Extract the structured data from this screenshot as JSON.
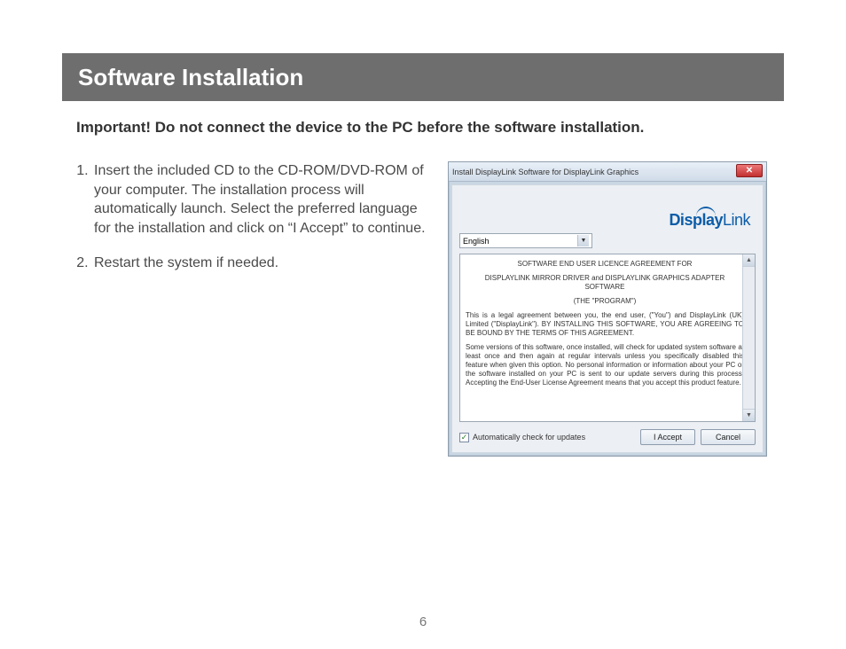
{
  "header": {
    "title": "Software Installation"
  },
  "notice": "Important!  Do not connect the device to the PC before the software installation.",
  "steps": [
    "Insert the included CD to the CD-ROM/DVD-ROM of your computer.  The installation process will automatically launch.  Select the preferred language for the installation and click on “I Accept” to continue.",
    "Restart the system if needed."
  ],
  "dialog": {
    "title": "Install DisplayLink Software for DisplayLink Graphics",
    "logo": {
      "bold_part": "Display",
      "reg_part": "Link"
    },
    "language": "English",
    "license": {
      "heading1": "SOFTWARE END USER LICENCE AGREEMENT FOR",
      "heading2": "DISPLAYLINK MIRROR DRIVER and DISPLAYLINK GRAPHICS ADAPTER SOFTWARE",
      "heading3": "(THE \"PROGRAM\")",
      "para1": "This is a legal agreement between you, the end user, (\"You\") and DisplayLink (UK) Limited (\"DisplayLink\"). BY INSTALLING THIS SOFTWARE, YOU ARE AGREEING TO BE BOUND BY THE TERMS OF THIS AGREEMENT.",
      "para2": "Some versions of this software, once installed, will check for updated system software at least once and then again at regular intervals unless you specifically disabled this feature when given this option. No personal information or information about your PC or the software installed on your PC is sent to our update servers during this process. Accepting the End-User License Agreement means that you accept this product feature."
    },
    "checkbox_label": "Automatically check for updates",
    "checkbox_checked": "✓",
    "accept_btn": "I Accept",
    "cancel_btn": "Cancel"
  },
  "page_number": "6"
}
